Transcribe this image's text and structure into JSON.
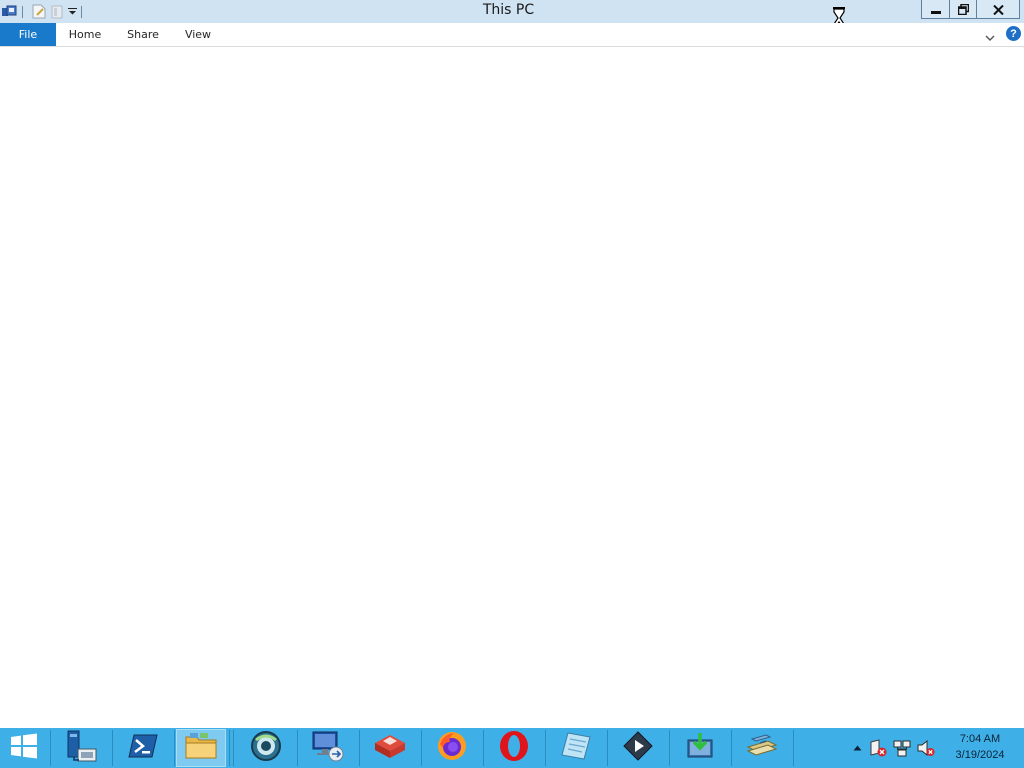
{
  "window": {
    "title": "This PC",
    "quick_access_icons": [
      "properties-icon",
      "new-folder-icon",
      "undo-icon",
      "customize-dropdown-icon"
    ]
  },
  "ribbon": {
    "tabs": [
      {
        "label": "File",
        "active": true
      },
      {
        "label": "Home"
      },
      {
        "label": "Share"
      },
      {
        "label": "View"
      }
    ],
    "help_label": "?"
  },
  "taskbar": {
    "apps": [
      "start-windows-icon",
      "server-manager-icon",
      "powershell-icon",
      "file-explorer-icon",
      "network-globe-icon",
      "remote-desktop-icon",
      "toolbox-app-icon",
      "firefox-icon",
      "opera-icon",
      "notepad-icon",
      "media-player-icon",
      "download-manager-icon",
      "file-transfer-icon"
    ],
    "tray_icons": [
      "show-hidden-icons-icon",
      "action-center-icon",
      "network-icon",
      "volume-muted-icon"
    ],
    "time": "7:04 AM",
    "date": "3/19/2024"
  },
  "colors": {
    "titlebar": "#cfe3f3",
    "file_tab": "#1979ca",
    "taskbar": "#3fb0e7"
  }
}
